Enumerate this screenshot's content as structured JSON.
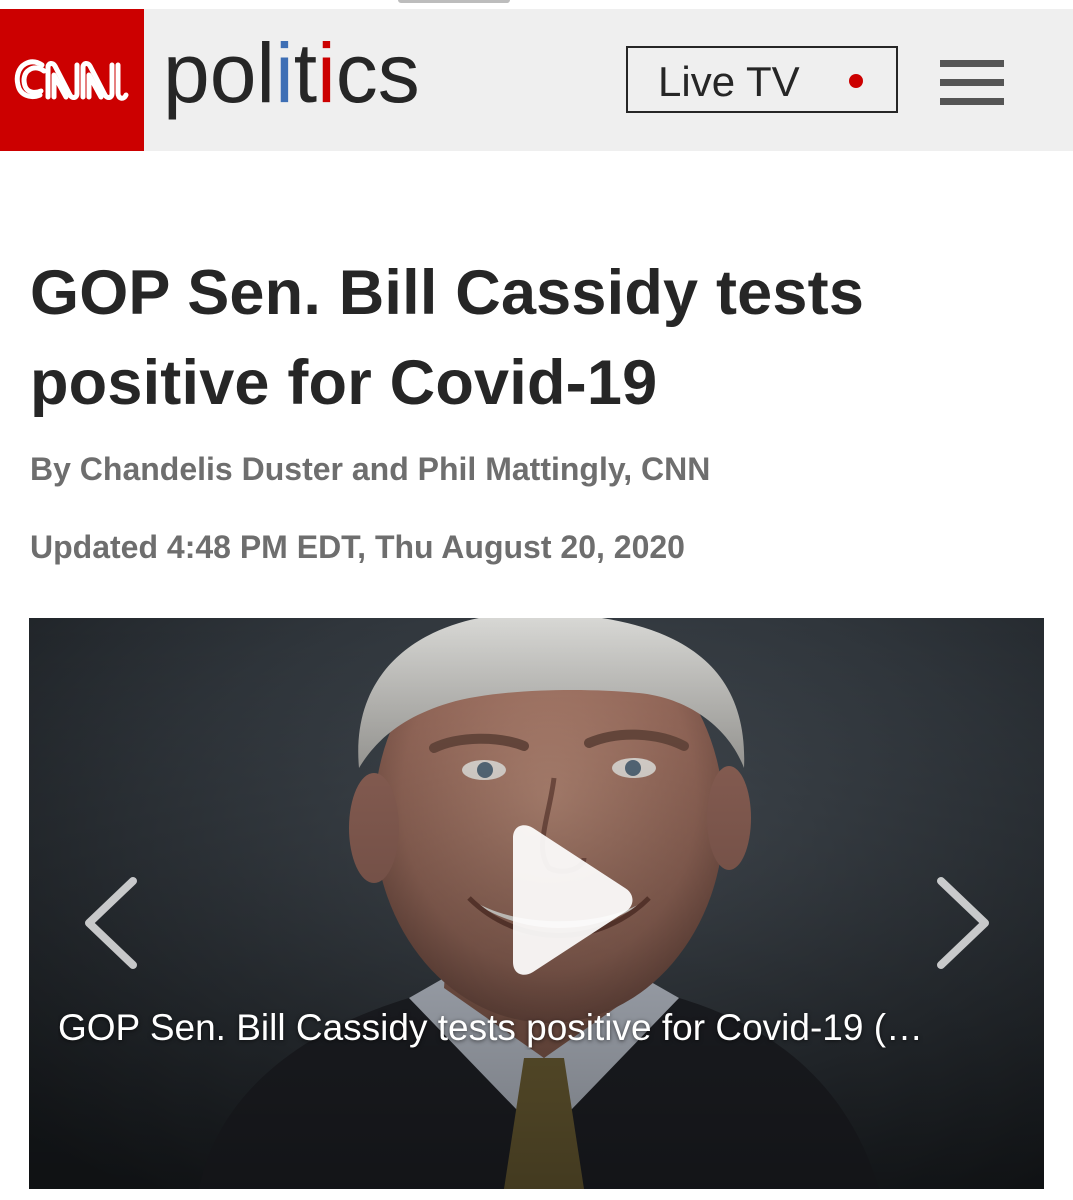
{
  "header": {
    "logo_text": "CNN",
    "section_title_parts": [
      "pol",
      "i",
      "t",
      "i",
      "cs"
    ],
    "live_tv_label": "Live TV",
    "menu_icon": "hamburger-menu-icon",
    "colors": {
      "brand_red": "#cc0000",
      "politics_blue": "#3e6fb5",
      "header_bg": "#efefef",
      "text_dark": "#262626"
    }
  },
  "article": {
    "headline": "GOP Sen. Bill Cassidy tests positive for Covid-19",
    "byline": "By Chandelis Duster and Phil Mattingly, CNN",
    "timestamp": "Updated 4:48 PM EDT, Thu August 20, 2020"
  },
  "video": {
    "caption": "GOP Sen. Bill Cassidy tests positive for Covid-19 (",
    "caption_ellipsis": "…",
    "play_icon": "play-icon",
    "prev_icon": "chevron-left-icon",
    "next_icon": "chevron-right-icon"
  }
}
